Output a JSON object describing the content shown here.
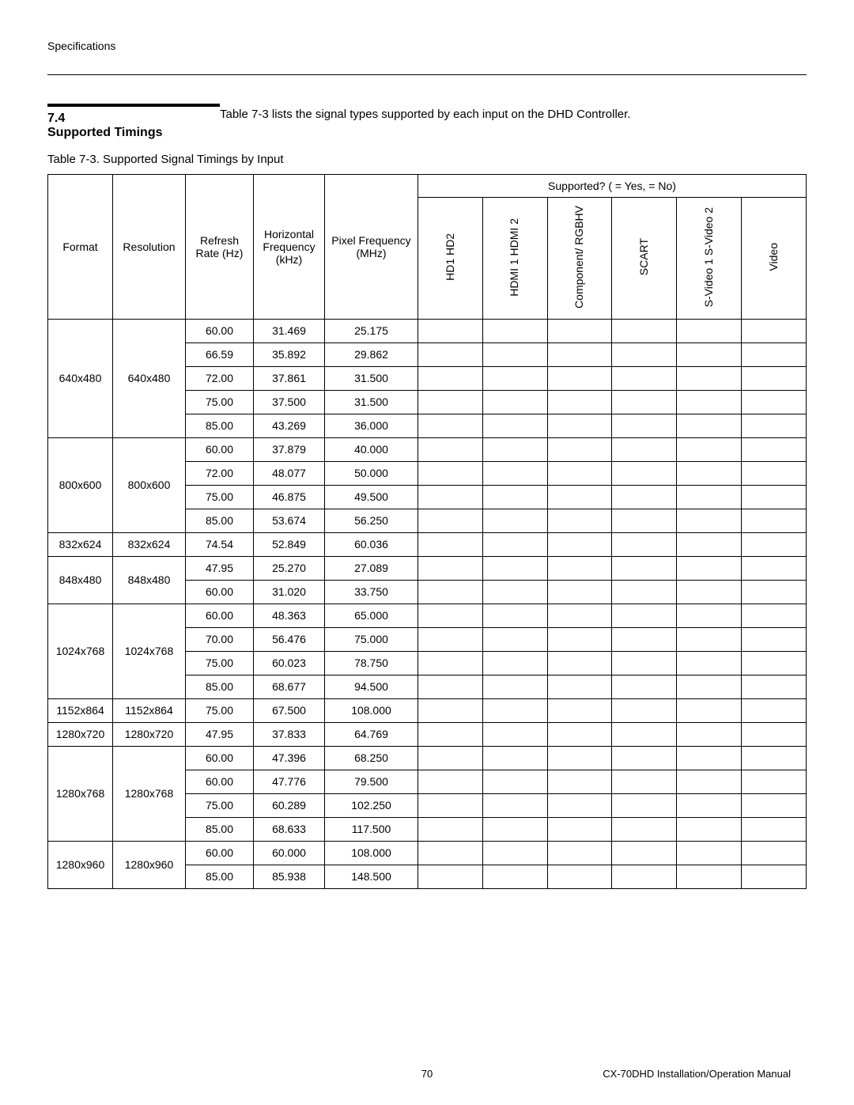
{
  "page": {
    "header_label": "Specifications",
    "section_number": "7.4",
    "section_title": "Supported Timings",
    "intro_text": "Table 7-3 lists the signal types supported by each input on the DHD Controller.",
    "table_caption": "Table 7-3. Supported Signal Timings by Input",
    "page_number": "70",
    "footer_right": "CX-70DHD Installation/Operation Manual"
  },
  "table": {
    "headers": {
      "format": "Format",
      "resolution": "Resolution",
      "refresh": "Refresh Rate (Hz)",
      "horiz": "Horizontal Frequency (kHz)",
      "pixel": "Pixel Frequency (MHz)",
      "supported_legend": "Supported? (   = Yes,    = No)",
      "col_hd": "HD1\nHD2",
      "col_hdmi": "HDMI 1\nHDMI 2",
      "col_comp": "Component/\nRGBHV",
      "col_scart": "SCART",
      "col_svideo": "S-Video 1\nS-Video 2",
      "col_video": "Video"
    },
    "groups": [
      {
        "format": "640x480",
        "resolution": "640x480",
        "rows": [
          {
            "refresh": "60.00",
            "horiz": "31.469",
            "pixel": "25.175"
          },
          {
            "refresh": "66.59",
            "horiz": "35.892",
            "pixel": "29.862"
          },
          {
            "refresh": "72.00",
            "horiz": "37.861",
            "pixel": "31.500"
          },
          {
            "refresh": "75.00",
            "horiz": "37.500",
            "pixel": "31.500"
          },
          {
            "refresh": "85.00",
            "horiz": "43.269",
            "pixel": "36.000"
          }
        ]
      },
      {
        "format": "800x600",
        "resolution": "800x600",
        "rows": [
          {
            "refresh": "60.00",
            "horiz": "37.879",
            "pixel": "40.000"
          },
          {
            "refresh": "72.00",
            "horiz": "48.077",
            "pixel": "50.000"
          },
          {
            "refresh": "75.00",
            "horiz": "46.875",
            "pixel": "49.500"
          },
          {
            "refresh": "85.00",
            "horiz": "53.674",
            "pixel": "56.250"
          }
        ]
      },
      {
        "format": "832x624",
        "resolution": "832x624",
        "rows": [
          {
            "refresh": "74.54",
            "horiz": "52.849",
            "pixel": "60.036"
          }
        ]
      },
      {
        "format": "848x480",
        "resolution": "848x480",
        "rows": [
          {
            "refresh": "47.95",
            "horiz": "25.270",
            "pixel": "27.089"
          },
          {
            "refresh": "60.00",
            "horiz": "31.020",
            "pixel": "33.750"
          }
        ]
      },
      {
        "format": "1024x768",
        "resolution": "1024x768",
        "rows": [
          {
            "refresh": "60.00",
            "horiz": "48.363",
            "pixel": "65.000"
          },
          {
            "refresh": "70.00",
            "horiz": "56.476",
            "pixel": "75.000"
          },
          {
            "refresh": "75.00",
            "horiz": "60.023",
            "pixel": "78.750"
          },
          {
            "refresh": "85.00",
            "horiz": "68.677",
            "pixel": "94.500"
          }
        ]
      },
      {
        "format": "1152x864",
        "resolution": "1152x864",
        "rows": [
          {
            "refresh": "75.00",
            "horiz": "67.500",
            "pixel": "108.000"
          }
        ]
      },
      {
        "format": "1280x720",
        "resolution": "1280x720",
        "rows": [
          {
            "refresh": "47.95",
            "horiz": "37.833",
            "pixel": "64.769"
          }
        ]
      },
      {
        "format": "1280x768",
        "resolution": "1280x768",
        "rows": [
          {
            "refresh": "60.00",
            "horiz": "47.396",
            "pixel": "68.250"
          },
          {
            "refresh": "60.00",
            "horiz": "47.776",
            "pixel": "79.500"
          },
          {
            "refresh": "75.00",
            "horiz": "60.289",
            "pixel": "102.250"
          },
          {
            "refresh": "85.00",
            "horiz": "68.633",
            "pixel": "117.500"
          }
        ]
      },
      {
        "format": "1280x960",
        "resolution": "1280x960",
        "rows": [
          {
            "refresh": "60.00",
            "horiz": "60.000",
            "pixel": "108.000"
          },
          {
            "refresh": "85.00",
            "horiz": "85.938",
            "pixel": "148.500"
          }
        ]
      }
    ]
  }
}
